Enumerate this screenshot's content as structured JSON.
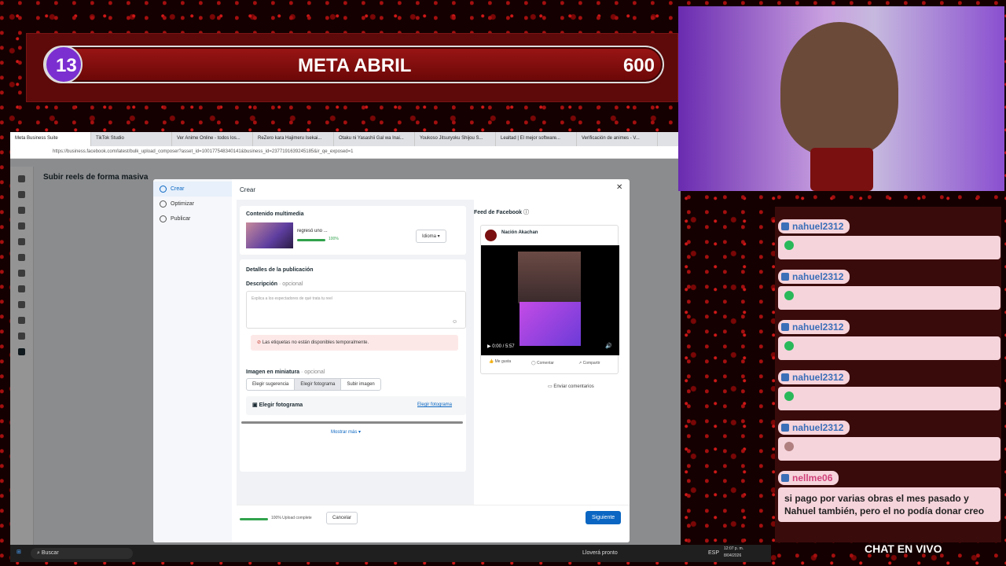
{
  "overlay": {
    "left": "13",
    "title": "META ABRIL",
    "right": "600"
  },
  "browser": {
    "tabs": [
      "Meta Business Suite",
      "TikTok Studio",
      "Ver Anime Online - todos los...",
      "ReZero kara Hajimeru Isekai...",
      "Otaku ni Yasashii Gal wa Inai...",
      "Youkoso Jitsuryoku Shijou S...",
      "Lealtad | El mejor software...",
      "Verificación de animes - V..."
    ],
    "url": "https://business.facebook.com/latest/bulk_upload_composer?asset_id=100177548340141&business_id=2377191639245185&ir_qe_exposed=1"
  },
  "page": {
    "title": "Subir reels de forma masiva"
  },
  "modal": {
    "title": "Crear",
    "steps": [
      "Crear",
      "Optimizar",
      "Publicar"
    ],
    "media": {
      "heading": "Contenido multimedia",
      "file": "regresó uno ...",
      "pct": "100%",
      "lang": "Idioma"
    },
    "details": {
      "heading": "Detalles de la publicación",
      "desc_label": "Descripción",
      "optional": "· opcional",
      "desc_ph": "Explica a los espectadores de qué trata tu reel",
      "tags_error": "Las etiquetas no están disponibles temporalmente."
    },
    "thumbnail": {
      "heading": "Imagen en miniatura",
      "optional": "· opcional",
      "options": [
        "Elegir sugerencia",
        "Elegir fotograma",
        "Subir imagen"
      ],
      "frame_label": "Elegir fotograma",
      "frame_link": "Elegir fotograma",
      "more": "Mostrar más"
    },
    "preview": {
      "heading": "Feed de Facebook",
      "page": "Nación Akachan",
      "time": "0:00 / 5:57",
      "like": "Me gusta",
      "comment": "Comentar",
      "share": "Compartir",
      "feedback": "Enviar comentarios"
    },
    "footer": {
      "upload": "100% Upload complete",
      "cancel": "Cancelar",
      "next": "Siguiente"
    }
  },
  "chat": {
    "messages": [
      {
        "user": "nahuel2312",
        "text": ""
      },
      {
        "user": "nahuel2312",
        "text": ""
      },
      {
        "user": "nahuel2312",
        "text": ""
      },
      {
        "user": "nahuel2312",
        "text": ""
      },
      {
        "user": "nahuel2312",
        "text": ""
      },
      {
        "user": "nellme06",
        "text": "si pago por varias obras el mes pasado y Nahuel también, pero el no podía donar creo"
      }
    ],
    "label": "CHAT EN VIVO"
  },
  "taskbar": {
    "search": "Buscar",
    "weather": "Lloverá pronto",
    "lang": "ESP",
    "time": "12:07 p. m.",
    "date": "8/04/2026"
  }
}
